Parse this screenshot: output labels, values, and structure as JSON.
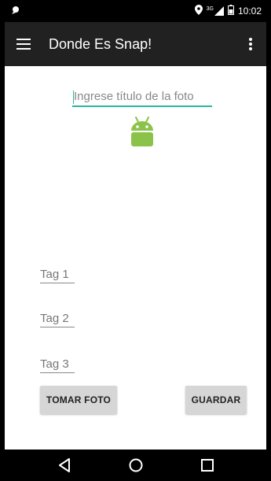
{
  "status_bar": {
    "time": "10:02",
    "network_label": "3G",
    "icons": [
      "notification-icon",
      "location-icon",
      "signal-icon",
      "battery-icon"
    ]
  },
  "app_bar": {
    "title": "Donde Es Snap!",
    "menu_icon": "hamburger-menu-icon",
    "overflow_icon": "more-vert-icon"
  },
  "form": {
    "title_placeholder": "Ingrese título de la foto",
    "tags": [
      {
        "placeholder": "Tag 1"
      },
      {
        "placeholder": "Tag 2"
      },
      {
        "placeholder": "Tag 3"
      }
    ],
    "take_photo_label": "TOMAR FOTO",
    "save_label": "GUARDAR"
  },
  "nav_bar": {
    "icons": [
      "back-icon",
      "home-icon",
      "recents-icon"
    ]
  },
  "colors": {
    "accent": "#2ab4a0",
    "app_bar_bg": "#212121",
    "android_green": "#8bc34a",
    "button_bg": "#d6d6d6"
  }
}
